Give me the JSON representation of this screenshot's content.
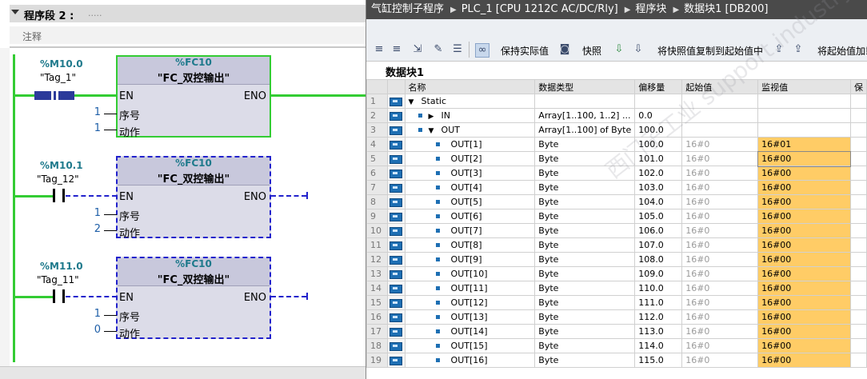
{
  "ladder": {
    "network_title": "程序段 2 :",
    "network_dots": ".....",
    "comment_label": "注释",
    "rungs": [
      {
        "contact_addr": "%M10.0",
        "contact_tag": "\"Tag_1\"",
        "fc_addr": "%FC10",
        "fc_name": "\"FC_双控输出\"",
        "pin_en": "EN",
        "pin_eno": "ENO",
        "param1_name": "序号",
        "param1_value": "1",
        "param2_name": "动作",
        "param2_value": "1"
      },
      {
        "contact_addr": "%M10.1",
        "contact_tag": "\"Tag_12\"",
        "fc_addr": "%FC10",
        "fc_name": "\"FC_双控输出\"",
        "pin_en": "EN",
        "pin_eno": "ENO",
        "param1_name": "序号",
        "param1_value": "1",
        "param2_name": "动作",
        "param2_value": "2"
      },
      {
        "contact_addr": "%M11.0",
        "contact_tag": "\"Tag_11\"",
        "fc_addr": "%FC10",
        "fc_name": "\"FC_双控输出\"",
        "pin_en": "EN",
        "pin_eno": "ENO",
        "param1_name": "序号",
        "param1_value": "1",
        "param2_name": "动作",
        "param2_value": "0"
      }
    ]
  },
  "breadcrumb": [
    "气缸控制子程序",
    "PLC_1 [CPU 1212C AC/DC/Rly]",
    "程序块",
    "数据块1 [DB200]"
  ],
  "toolbar": {
    "keep_actual": "保持实际值",
    "snapshot": "快照",
    "copy_snapshot": "将快照值复制到起始值中",
    "load_start": "将起始值加载"
  },
  "db_title": "数据块1",
  "columns": [
    "名称",
    "数据类型",
    "偏移量",
    "起始值",
    "监视值",
    "保"
  ],
  "rows": [
    {
      "n": "1",
      "name": "Static",
      "level": 0,
      "expand": "down",
      "type": "",
      "offset": "",
      "start": "",
      "monitor": ""
    },
    {
      "n": "2",
      "name": "IN",
      "level": 1,
      "expand": "right",
      "type": "Array[1..100, 1..2] ...",
      "offset": "0.0",
      "start": "",
      "monitor": ""
    },
    {
      "n": "3",
      "name": "OUT",
      "level": 1,
      "expand": "down",
      "type": "Array[1..100] of Byte",
      "offset": "100.0",
      "start": "",
      "monitor": ""
    },
    {
      "n": "4",
      "name": "OUT[1]",
      "level": 2,
      "expand": "",
      "type": "Byte",
      "offset": "100.0",
      "start": "16#0",
      "monitor": "16#01"
    },
    {
      "n": "5",
      "name": "OUT[2]",
      "level": 2,
      "expand": "",
      "type": "Byte",
      "offset": "101.0",
      "start": "16#0",
      "monitor": "16#00"
    },
    {
      "n": "6",
      "name": "OUT[3]",
      "level": 2,
      "expand": "",
      "type": "Byte",
      "offset": "102.0",
      "start": "16#0",
      "monitor": "16#00"
    },
    {
      "n": "7",
      "name": "OUT[4]",
      "level": 2,
      "expand": "",
      "type": "Byte",
      "offset": "103.0",
      "start": "16#0",
      "monitor": "16#00"
    },
    {
      "n": "8",
      "name": "OUT[5]",
      "level": 2,
      "expand": "",
      "type": "Byte",
      "offset": "104.0",
      "start": "16#0",
      "monitor": "16#00"
    },
    {
      "n": "9",
      "name": "OUT[6]",
      "level": 2,
      "expand": "",
      "type": "Byte",
      "offset": "105.0",
      "start": "16#0",
      "monitor": "16#00"
    },
    {
      "n": "10",
      "name": "OUT[7]",
      "level": 2,
      "expand": "",
      "type": "Byte",
      "offset": "106.0",
      "start": "16#0",
      "monitor": "16#00"
    },
    {
      "n": "11",
      "name": "OUT[8]",
      "level": 2,
      "expand": "",
      "type": "Byte",
      "offset": "107.0",
      "start": "16#0",
      "monitor": "16#00"
    },
    {
      "n": "12",
      "name": "OUT[9]",
      "level": 2,
      "expand": "",
      "type": "Byte",
      "offset": "108.0",
      "start": "16#0",
      "monitor": "16#00"
    },
    {
      "n": "13",
      "name": "OUT[10]",
      "level": 2,
      "expand": "",
      "type": "Byte",
      "offset": "109.0",
      "start": "16#0",
      "monitor": "16#00"
    },
    {
      "n": "14",
      "name": "OUT[11]",
      "level": 2,
      "expand": "",
      "type": "Byte",
      "offset": "110.0",
      "start": "16#0",
      "monitor": "16#00"
    },
    {
      "n": "15",
      "name": "OUT[12]",
      "level": 2,
      "expand": "",
      "type": "Byte",
      "offset": "111.0",
      "start": "16#0",
      "monitor": "16#00"
    },
    {
      "n": "16",
      "name": "OUT[13]",
      "level": 2,
      "expand": "",
      "type": "Byte",
      "offset": "112.0",
      "start": "16#0",
      "monitor": "16#00"
    },
    {
      "n": "17",
      "name": "OUT[14]",
      "level": 2,
      "expand": "",
      "type": "Byte",
      "offset": "113.0",
      "start": "16#0",
      "monitor": "16#00"
    },
    {
      "n": "18",
      "name": "OUT[15]",
      "level": 2,
      "expand": "",
      "type": "Byte",
      "offset": "114.0",
      "start": "16#0",
      "monitor": "16#00"
    },
    {
      "n": "19",
      "name": "OUT[16]",
      "level": 2,
      "expand": "",
      "type": "Byte",
      "offset": "115.0",
      "start": "16#0",
      "monitor": "16#00"
    }
  ],
  "watermark": "西门子工业 support.industry.siemens.com"
}
